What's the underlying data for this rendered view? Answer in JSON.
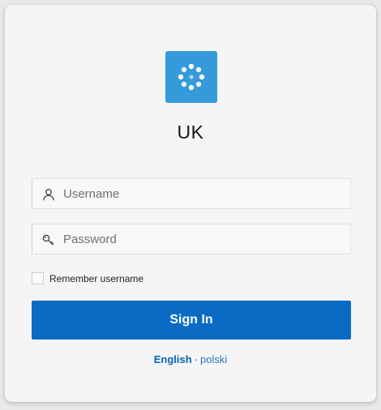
{
  "app": {
    "title": "UK"
  },
  "login": {
    "username_placeholder": "Username",
    "password_placeholder": "Password",
    "remember_label": "Remember username",
    "remember_checked": false,
    "signin_label": "Sign In"
  },
  "languages": {
    "active": "English",
    "separator": "·",
    "other": "polski"
  },
  "icons": {
    "logo": "dots-logo-icon",
    "username": "user-icon",
    "password": "key-icon"
  },
  "colors": {
    "logo_bg": "#349ad9",
    "primary_button": "#0a6bc5",
    "link": "#0a65b5"
  }
}
